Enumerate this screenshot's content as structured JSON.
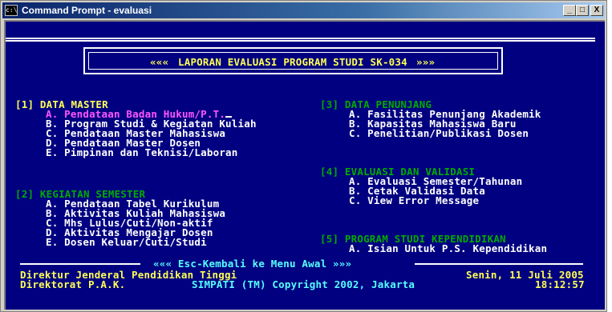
{
  "window": {
    "title": "Command Prompt - evaluasi",
    "icon_label": "c:\\",
    "controls": [
      "_",
      "□",
      "X"
    ]
  },
  "header": {
    "left_marker": "«««",
    "title": "LAPORAN EVALUASI PROGRAM STUDI SK-034",
    "right_marker": "»»»"
  },
  "menu": {
    "section1": {
      "heading": "[1] DATA MASTER",
      "items": [
        "A. Pendataan Badan Hukum/P.T.",
        "B. Program Studi & Kegiatan Kuliah",
        "C. Pendataan Master Mahasiswa",
        "D. Pendataan Master Dosen",
        "E. Pimpinan dan Teknisi/Laboran"
      ]
    },
    "section2": {
      "heading": "[2] KEGIATAN SEMESTER",
      "items": [
        "A. Pendataan Tabel Kurikulum",
        "B. Aktivitas Kuliah Mahasiswa",
        "C. Mhs Lulus/Cuti/Non-aktif",
        "D. Aktivitas Mengajar Dosen",
        "E. Dosen Keluar/Cuti/Studi"
      ]
    },
    "section3": {
      "heading": "[3] DATA PENUNJANG",
      "items": [
        "A. Fasilitas Penunjang Akademik",
        "B. Kapasitas Mahasiswa Baru",
        "C. Penelitian/Publikasi Dosen"
      ]
    },
    "section4": {
      "heading": "[4] EVALUASI DAN VALIDASI",
      "items": [
        "A. Evaluasi Semester/Tahunan",
        "B. Cetak Validasi Data",
        "C. View Error Message"
      ]
    },
    "section5": {
      "heading": "[5] PROGRAM STUDI KEPENDIDIKAN",
      "items": [
        "A. Isian Untuk P.S. Kependidikan"
      ]
    }
  },
  "footer": {
    "esc_hint": "««« Esc-Kembali ke Menu Awal »»»",
    "org_line1": "Direktur Jenderal Pendidikan Tinggi",
    "org_line2": "Direktorat P.A.K.",
    "copyright": "SIMPATI (TM) Copyright 2002, Jakarta",
    "date": "Senin, 11 Juli 2005",
    "time": "18:12:57"
  },
  "colors": {
    "background": "#000080",
    "heading_section1": "#ffff55",
    "heading_other": "#00aa00",
    "selected_item": "#ff55ff",
    "item": "#ffffff",
    "footer_text": "#ffff55",
    "copyright_text": "#55ffff"
  }
}
